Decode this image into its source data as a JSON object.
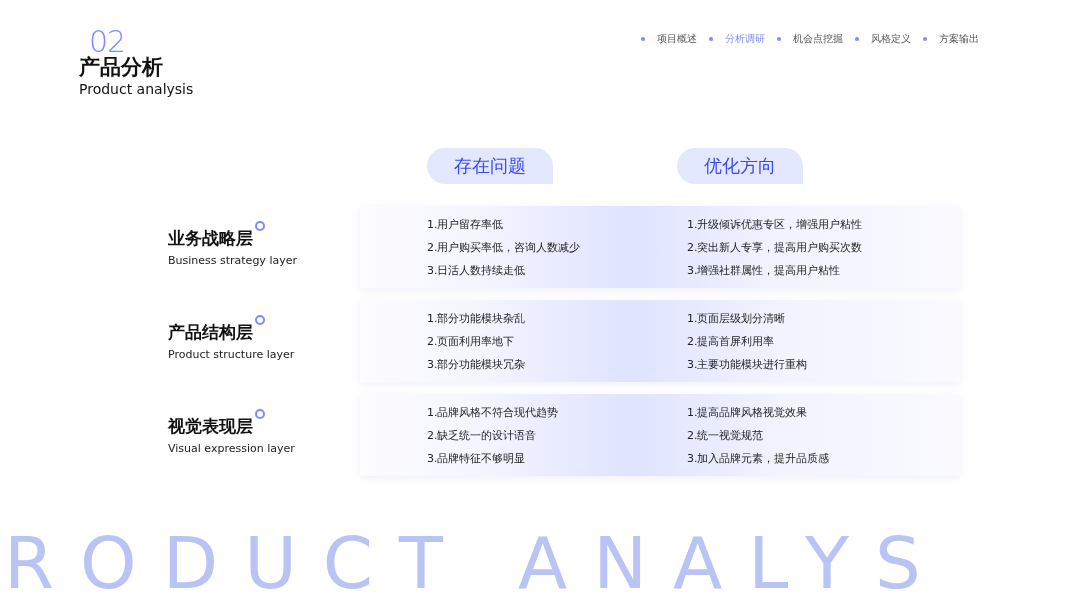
{
  "header": {
    "number": "02",
    "title": "产品分析",
    "subtitle": "Product analysis"
  },
  "nav": [
    {
      "label": "项目概述",
      "selected": false
    },
    {
      "label": "分析调研",
      "selected": true
    },
    {
      "label": "机会点挖掘",
      "selected": false
    },
    {
      "label": "风格定义",
      "selected": false
    },
    {
      "label": "方案输出",
      "selected": false
    }
  ],
  "columns": [
    "存在问题",
    "优化方向"
  ],
  "rows": [
    {
      "title": "业务战略层",
      "subtitle": "Business strategy layer",
      "problems": [
        "1.用户留存率低",
        "2.用户购买率低，咨询人数减少",
        "3.日活人数持续走低"
      ],
      "solutions": [
        "1.升级倾诉优惠专区，增强用户粘性",
        "2.突出新人专享，提高用户购买次数",
        "3.增强社群属性，提高用户粘性"
      ]
    },
    {
      "title": "产品结构层",
      "subtitle": "Product structure layer",
      "problems": [
        "1.部分功能模块杂乱",
        "2.页面利用率地下",
        "3.部分功能模块冗杂"
      ],
      "solutions": [
        "1.页面层级划分清晰",
        "2.提高首屏利用率",
        "3.主要功能模块进行重构"
      ]
    },
    {
      "title": "视觉表现层",
      "subtitle": "Visual expression layer",
      "problems": [
        "1.品牌风格不符合现代趋势",
        "2.缺乏统一的设计语音",
        "3.品牌特征不够明显"
      ],
      "solutions": [
        "1.提高品牌风格视觉效果",
        "2.统一视觉规范",
        "3.加入品牌元素，提升品质感"
      ]
    }
  ],
  "background_text": "RODUCT ANALYS"
}
